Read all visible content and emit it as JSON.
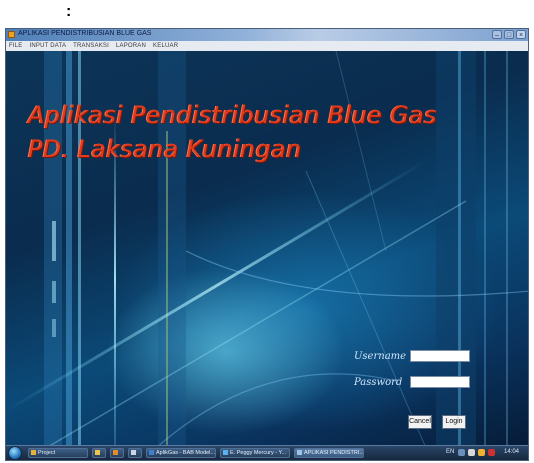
{
  "document": {
    "colon": ":"
  },
  "window": {
    "title": "APLIKASI PENDISTRIBUSIAN BLUE GAS",
    "minimize": "–",
    "maximize": "□",
    "close": "×"
  },
  "menu": {
    "items": [
      "FILE",
      "INPUT DATA",
      "TRANSAKSI",
      "LAPORAN",
      "KELUAR"
    ]
  },
  "headline": {
    "line1": "Aplikasi Pendistribusian Blue Gas",
    "line2": "PD. Laksana Kuningan"
  },
  "login": {
    "username_label": "Username",
    "password_label": "Password",
    "cancel_label": "Cancel",
    "login_label": "Login"
  },
  "taskbar": {
    "tasks": [
      {
        "label": "Project",
        "icon": "folder-icon"
      },
      {
        "label": "",
        "icon": "explorer-icon"
      },
      {
        "label": "",
        "icon": "settings-icon"
      },
      {
        "label": "",
        "icon": "app-icon"
      },
      {
        "label": "AplikGas - BAB Model...",
        "icon": "document-icon"
      },
      {
        "label": "E. Peggy Mercury - Y...",
        "icon": "browser-icon"
      },
      {
        "label": "APLIKASI PENDISTRI...",
        "icon": "window-icon"
      }
    ],
    "language": "EN",
    "clock": "14:04"
  },
  "colors": {
    "headline": "#e23a1c",
    "accent_title": "#4f7fb8",
    "background": "#0a2c4e"
  }
}
